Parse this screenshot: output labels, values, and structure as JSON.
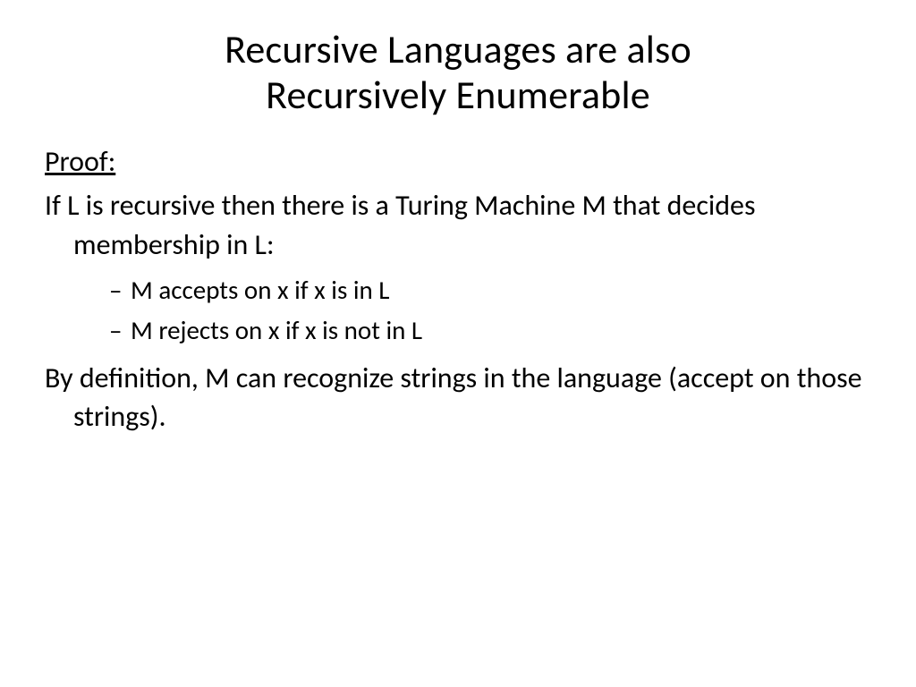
{
  "title_line1": "Recursive Languages are also",
  "title_line2": "Recursively Enumerable",
  "proof_label": "Proof:",
  "paragraph1": "If L is recursive then there is a Turing Machine M that decides membership in L:",
  "sub_items": [
    "M accepts on x if x is in L",
    "M rejects on x if x is not in L"
  ],
  "paragraph2": "By definition, M can recognize strings in the language (accept on those strings)."
}
